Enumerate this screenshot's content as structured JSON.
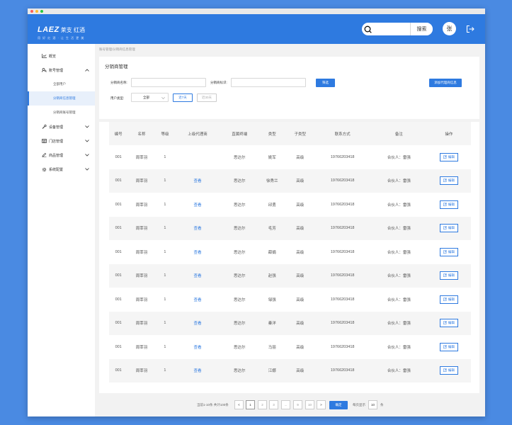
{
  "window": {
    "dot_colors": [
      "#ff5f57",
      "#ffbd2e",
      "#28c940"
    ]
  },
  "header": {
    "logo_main": "LAEZ",
    "logo_cn": "莱支 红酒",
    "logo_tagline": "用 好 红 酒 · 让 生 活 更 美",
    "search_placeholder": "",
    "search_button": "搜索",
    "avatar_text": "张",
    "accent": "#2e7ae0"
  },
  "sidebar": {
    "items": [
      {
        "label": "概览",
        "icon": "chart-line-icon",
        "expandable": false
      },
      {
        "label": "账号管理",
        "icon": "user-search-icon",
        "expandable": true,
        "expanded": true,
        "children": [
          {
            "label": "全部用户",
            "active": false
          },
          {
            "label": "分销商信息管理",
            "active": true
          },
          {
            "label": "分销商账号管理",
            "active": false
          }
        ]
      },
      {
        "label": "设备管理",
        "icon": "wrench-icon",
        "expandable": true
      },
      {
        "label": "门店管理",
        "icon": "store-icon",
        "expandable": true
      },
      {
        "label": "商品管理",
        "icon": "pen-icon",
        "expandable": true
      },
      {
        "label": "系统配置",
        "icon": "gear-icon",
        "expandable": true
      }
    ]
  },
  "breadcrumb": "账号管理/分销商信息管理",
  "filter": {
    "title": "分销商管理",
    "name_label": "分销商名称:",
    "name_value": "",
    "id_label": "分销商标识:",
    "id_value": "",
    "filter_button": "筛选",
    "add_button": "添加代理商信息",
    "user_type_label": "用户类型:",
    "user_type_value": "全部",
    "recent_7": "近7天",
    "recent_30": "近30天"
  },
  "table": {
    "columns": [
      "编号",
      "名称",
      "等级",
      "上级代理商",
      "直属终端",
      "类型",
      "子类型",
      "联系方式",
      "备注",
      "操作"
    ],
    "edit_label": "编辑",
    "rows": [
      {
        "id": "001",
        "name": "周莘羽",
        "level": "1",
        "parent": "",
        "terminal": "思达尔",
        "type": "姚军",
        "subtype": "高级",
        "contact": "19766203418",
        "note": "合伙人：雷强"
      },
      {
        "id": "001",
        "name": "周莘羽",
        "level": "1",
        "parent": "查看",
        "terminal": "思达尔",
        "type": "徐秀兰",
        "subtype": "高级",
        "contact": "19766203418",
        "note": "合伙人：雷强"
      },
      {
        "id": "001",
        "name": "周莘羽",
        "level": "1",
        "parent": "查看",
        "terminal": "思达尔",
        "type": "邱勇",
        "subtype": "高级",
        "contact": "19766203418",
        "note": "合伙人：雷强"
      },
      {
        "id": "001",
        "name": "周莘羽",
        "level": "1",
        "parent": "查看",
        "terminal": "思达尔",
        "type": "毛芳",
        "subtype": "高级",
        "contact": "19766203418",
        "note": "合伙人：雷强"
      },
      {
        "id": "001",
        "name": "周莘羽",
        "level": "1",
        "parent": "查看",
        "terminal": "思达尔",
        "type": "薛娟",
        "subtype": "高级",
        "contact": "19766203418",
        "note": "合伙人：雷强"
      },
      {
        "id": "001",
        "name": "周莘羽",
        "level": "1",
        "parent": "查看",
        "terminal": "思达尔",
        "type": "赵强",
        "subtype": "高级",
        "contact": "19766203418",
        "note": "合伙人：雷强"
      },
      {
        "id": "001",
        "name": "周莘羽",
        "level": "1",
        "parent": "查看",
        "terminal": "思达尔",
        "type": "邹强",
        "subtype": "高级",
        "contact": "19766203418",
        "note": "合伙人：雷强"
      },
      {
        "id": "001",
        "name": "周莘羽",
        "level": "1",
        "parent": "查看",
        "terminal": "思达尔",
        "type": "秦洋",
        "subtype": "高级",
        "contact": "19766203418",
        "note": "合伙人：雷强"
      },
      {
        "id": "001",
        "name": "周莘羽",
        "level": "1",
        "parent": "查看",
        "terminal": "思达尔",
        "type": "马丽",
        "subtype": "高级",
        "contact": "19766203418",
        "note": "合伙人：雷强"
      },
      {
        "id": "001",
        "name": "周莘羽",
        "level": "1",
        "parent": "查看",
        "terminal": "思达尔",
        "type": "江娜",
        "subtype": "高级",
        "contact": "19766203418",
        "note": "合伙人：雷强"
      }
    ]
  },
  "pagination": {
    "summary": "当前1-10条 共计100条",
    "prev": "<",
    "next": ">",
    "pages": [
      "1",
      "2",
      "3",
      "...",
      "9",
      "10"
    ],
    "current": "1",
    "confirm": "确定",
    "per_page_label": "每页显示",
    "per_page_value": "10",
    "unit": "条"
  }
}
